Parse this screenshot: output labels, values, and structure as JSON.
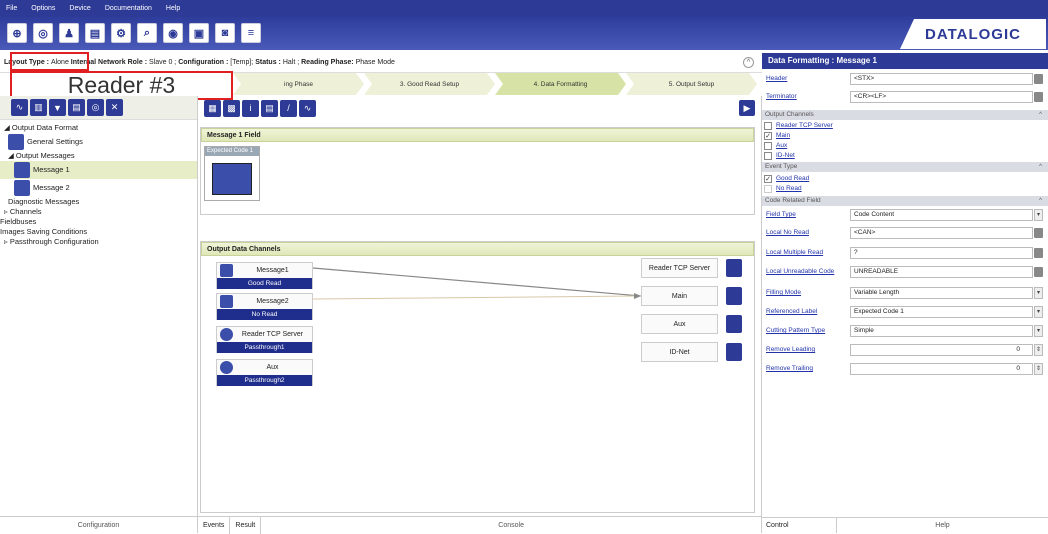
{
  "menu": [
    "File",
    "Options",
    "Device",
    "Documentation",
    "Help"
  ],
  "brand": "DATALOGIC",
  "toolbar_icons": [
    "connect-icon",
    "options-icon",
    "device-icon",
    "calendar-icon",
    "settings-icon",
    "diagnostics-icon",
    "monitor-icon",
    "calibrate-icon",
    "camera-icon",
    "network-icon"
  ],
  "infobar": {
    "layout_type_label": "Layout Type :",
    "layout_type_value": "Alone",
    "network_role_label": "Internal Network Role :",
    "network_role_value": "Slave 0 ;",
    "configuration_label": "Configuration :",
    "configuration_value": "[Temp];",
    "status_label": "Status :",
    "status_value": "Halt ;",
    "reading_phase_label": "Reading Phase:",
    "reading_phase_value": "Phase Mode"
  },
  "reader_label": "Reader #3",
  "steps": [
    {
      "label": "ing Phase"
    },
    {
      "label": "3. Good Read Setup"
    },
    {
      "label": "4. Data Formatting"
    },
    {
      "label": "5. Output Setup"
    }
  ],
  "tree": {
    "output_data_format": "Output Data Format",
    "general_settings": "General Settings",
    "output_messages": "Output Messages",
    "message1": "Message 1",
    "message2": "Message 2",
    "diagnostic_messages": "Diagnostic Messages",
    "channels": "Channels",
    "fieldbuses": "Fieldbuses",
    "images_saving": "Images Saving Conditions",
    "passthrough": "Passthrough Configuration"
  },
  "left_footer": "Configuration",
  "center": {
    "message_field_header": "Message 1 Field",
    "expected_code_label": "Expected Code 1",
    "output_channels_header": "Output Data Channels",
    "messages": [
      {
        "label": "Message1",
        "sub": "Good Read"
      },
      {
        "label": "Message2",
        "sub": "No Read"
      },
      {
        "label": "Reader TCP Server",
        "sub": "Passthrough1"
      },
      {
        "label": "Aux",
        "sub": "Passthrough2"
      }
    ],
    "destinations": [
      "Reader TCP Server",
      "Main",
      "Aux",
      "ID-Net"
    ]
  },
  "center_footer": {
    "events": "Events",
    "result": "Result",
    "console": "Console"
  },
  "right": {
    "title": "Data Formatting : Message 1",
    "header_label": "Header",
    "header_value": "<STX>",
    "terminator_label": "Terminator",
    "terminator_value": "<CR><LF>",
    "output_channels_section": "Output Channels",
    "channels": [
      {
        "label": "Reader TCP Server",
        "checked": false
      },
      {
        "label": "Main",
        "checked": true
      },
      {
        "label": "Aux",
        "checked": false
      },
      {
        "label": "ID-Net",
        "checked": false
      }
    ],
    "event_type_section": "Event Type",
    "events": [
      {
        "label": "Good Read",
        "checked": true
      },
      {
        "label": "No Read",
        "checked": false
      }
    ],
    "code_related_section": "Code Related Field",
    "fields": [
      {
        "label": "Field Type",
        "value": "Code Content",
        "kind": "drop"
      },
      {
        "label": "Local No Read",
        "value": "<CAN>",
        "kind": "btn"
      },
      {
        "label": "Local Multiple Read",
        "value": "?",
        "kind": "btn"
      },
      {
        "label": "Local Unreadable Code",
        "value": "UNREADABLE",
        "kind": "btn"
      },
      {
        "label": "Filling Mode",
        "value": "Variable Length",
        "kind": "drop"
      },
      {
        "label": "Referenced Label",
        "value": "Expected Code  1",
        "kind": "drop"
      },
      {
        "label": "Cutting Pattern Type",
        "value": "Simple",
        "kind": "drop"
      },
      {
        "label": "Remove Leading",
        "value": "0",
        "kind": "spin"
      },
      {
        "label": "Remove Trailing",
        "value": "0",
        "kind": "spin"
      }
    ],
    "footer_control": "Control",
    "footer_help": "Help"
  }
}
